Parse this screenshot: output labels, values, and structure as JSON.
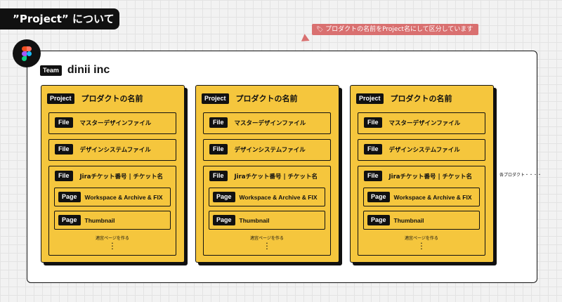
{
  "header": {
    "title": "”Project” について"
  },
  "note": {
    "emoji": "🏷",
    "text": "プロダクトの名前をProject名にして区分しています"
  },
  "team": {
    "tag": "Team",
    "name": "dinii inc"
  },
  "projects": [
    {
      "tag": "Project",
      "name": "プロダクトの名前",
      "files": [
        {
          "tag": "File",
          "name": "マスターデザインファイル"
        },
        {
          "tag": "File",
          "name": "デザインシステムファイル"
        },
        {
          "tag": "File",
          "name": "Jiraチケット番号 | チケット名",
          "pages": [
            {
              "tag": "Page",
              "name": "Workspace & Archive & FIX"
            },
            {
              "tag": "Page",
              "name": "Thumbnail"
            }
          ],
          "add_pages": "適宜ページを作る"
        }
      ]
    },
    {
      "tag": "Project",
      "name": "プロダクトの名前",
      "files": [
        {
          "tag": "File",
          "name": "マスターデザインファイル"
        },
        {
          "tag": "File",
          "name": "デザインシステムファイル"
        },
        {
          "tag": "File",
          "name": "Jiraチケット番号 | チケット名",
          "pages": [
            {
              "tag": "Page",
              "name": "Workspace & Archive & FIX"
            },
            {
              "tag": "Page",
              "name": "Thumbnail"
            }
          ],
          "add_pages": "適宜ページを作る"
        }
      ]
    },
    {
      "tag": "Project",
      "name": "プロダクトの名前",
      "files": [
        {
          "tag": "File",
          "name": "マスターデザインファイル"
        },
        {
          "tag": "File",
          "name": "デザインシステムファイル"
        },
        {
          "tag": "File",
          "name": "Jiraチケット番号 | チケット名",
          "pages": [
            {
              "tag": "Page",
              "name": "Workspace & Archive & FIX"
            },
            {
              "tag": "Page",
              "name": "Thumbnail"
            }
          ],
          "add_pages": "適宜ページを作る"
        }
      ]
    }
  ],
  "more_projects": "各プロダクト・・・・",
  "colors": {
    "project_bg": "#f5c63d",
    "note_bg": "#d97070",
    "ink": "#111111"
  },
  "icons": {
    "logo": "figma-logo-icon"
  }
}
